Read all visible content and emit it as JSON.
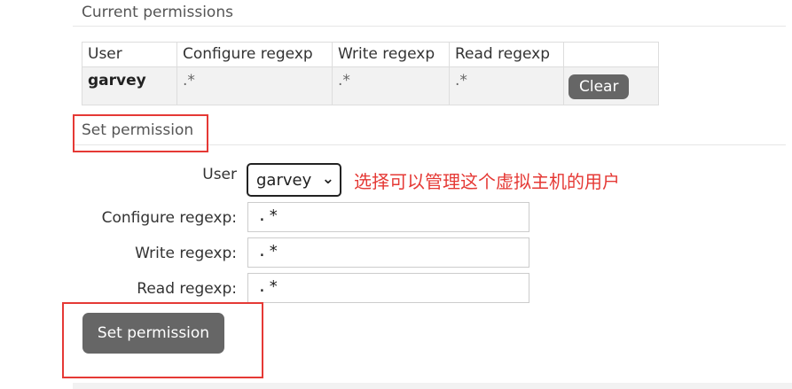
{
  "current": {
    "heading": "Current permissions",
    "columns": [
      "User",
      "Configure regexp",
      "Write regexp",
      "Read regexp",
      ""
    ],
    "rows": [
      {
        "user": "garvey",
        "configure": ".*",
        "write": ".*",
        "read": ".*",
        "action": "Clear"
      }
    ]
  },
  "set_permission": {
    "heading": "Set permission",
    "user_label": "User",
    "user_value": "garvey",
    "configure_label": "Configure regexp:",
    "configure_value": ".*",
    "write_label": "Write regexp:",
    "write_value": ".*",
    "read_label": "Read regexp:",
    "read_value": ".*",
    "submit_label": "Set permission"
  },
  "annotation": {
    "note": "选择可以管理这个虚拟主机的用户",
    "color": "#e53935"
  },
  "colors": {
    "button": "#666666",
    "table_row": "#f2f2f2"
  },
  "icons": {
    "select_chevron": "chevron-down-icon"
  }
}
